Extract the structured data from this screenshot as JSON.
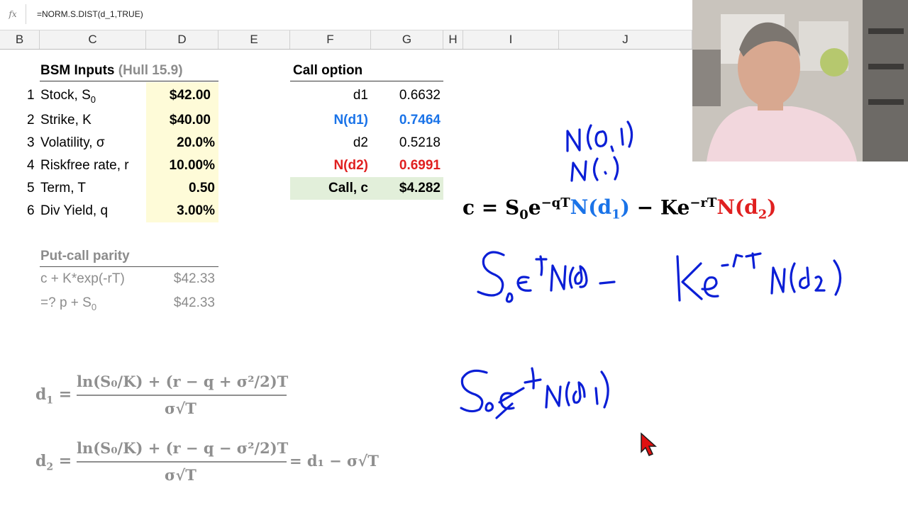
{
  "formula_bar": {
    "fx_label": "fx",
    "formula": "=NORM.S.DIST(d_1,TRUE)"
  },
  "columns": [
    "B",
    "C",
    "D",
    "E",
    "F",
    "G",
    "H",
    "I",
    "J"
  ],
  "inputs": {
    "title": "BSM Inputs",
    "source": "(Hull 15.9)",
    "rows": [
      {
        "n": "1",
        "label": "Stock, S",
        "sub": "0",
        "value": "$42.00"
      },
      {
        "n": "2",
        "label": "Strike, K",
        "sub": "",
        "value": "$40.00"
      },
      {
        "n": "3",
        "label": "Volatility, σ",
        "sub": "",
        "value": "20.0%"
      },
      {
        "n": "4",
        "label": "Riskfree rate, r",
        "sub": "",
        "value": "10.00%"
      },
      {
        "n": "5",
        "label": "Term, T",
        "sub": "",
        "value": "0.50"
      },
      {
        "n": "6",
        "label": "Div Yield, q",
        "sub": "",
        "value": "3.00%"
      }
    ]
  },
  "call_option": {
    "title": "Call option",
    "rows": [
      {
        "label": "d1",
        "value": "0.6632"
      },
      {
        "label": "N(d1)",
        "value": "0.7464"
      },
      {
        "label": "d2",
        "value": "0.5218"
      },
      {
        "label": "N(d2)",
        "value": "0.6991"
      },
      {
        "label": "Call, c",
        "value": "$4.282"
      }
    ]
  },
  "put_call_parity": {
    "title": "Put-call parity",
    "rows": [
      {
        "label": "c + K*exp(-rT)",
        "value": "$42.33"
      },
      {
        "label": "=? p + S",
        "sub": "0",
        "value": "$42.33"
      }
    ]
  },
  "formulas": {
    "d1_lhs": "d",
    "d1_sub": "1",
    "d1_num": "ln(S₀/K) + (r − q + σ²/2)T",
    "d1_den": "σ√T",
    "d2_lhs": "d",
    "d2_sub": "2",
    "d2_num": "ln(S₀/K) + (r − q − σ²/2)T",
    "d2_den": "σ√T",
    "d2_rhs": "= d₁ −  σ√T"
  },
  "colors": {
    "blue": "#1a73e8",
    "red": "#e02020",
    "input_fill": "#fefbd8",
    "result_fill": "#e2efda",
    "ink": "#0b1fd6"
  }
}
